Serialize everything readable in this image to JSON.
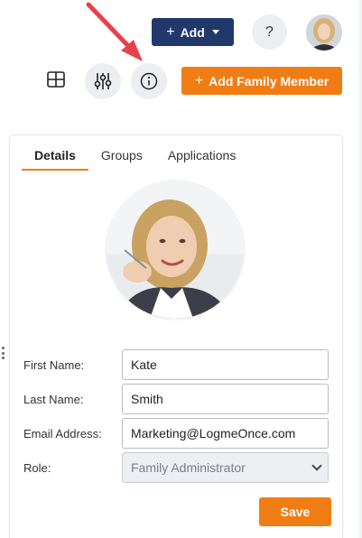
{
  "topbar": {
    "add_label": "Add",
    "help_label": "?"
  },
  "toolbar": {
    "add_family_label": "Add Family Member"
  },
  "tabs": [
    {
      "label": "Details",
      "active": true
    },
    {
      "label": "Groups",
      "active": false
    },
    {
      "label": "Applications",
      "active": false
    }
  ],
  "form": {
    "first_name_label": "First Name:",
    "first_name_value": "Kate",
    "last_name_label": "Last Name:",
    "last_name_value": "Smith",
    "email_label": "Email Address:",
    "email_value": "Marketing@LogmeOnce.com",
    "role_label": "Role:",
    "role_value": "Family Administrator",
    "save_label": "Save"
  },
  "colors": {
    "primary_navy": "#21386b",
    "accent_orange": "#f07d14",
    "annotation_arrow": "#e8404a"
  },
  "icons": {
    "grid": "grid-icon",
    "sliders": "sliders-icon",
    "info": "info-icon",
    "caret": "caret-down-icon",
    "arrow": "annotation-arrow"
  }
}
